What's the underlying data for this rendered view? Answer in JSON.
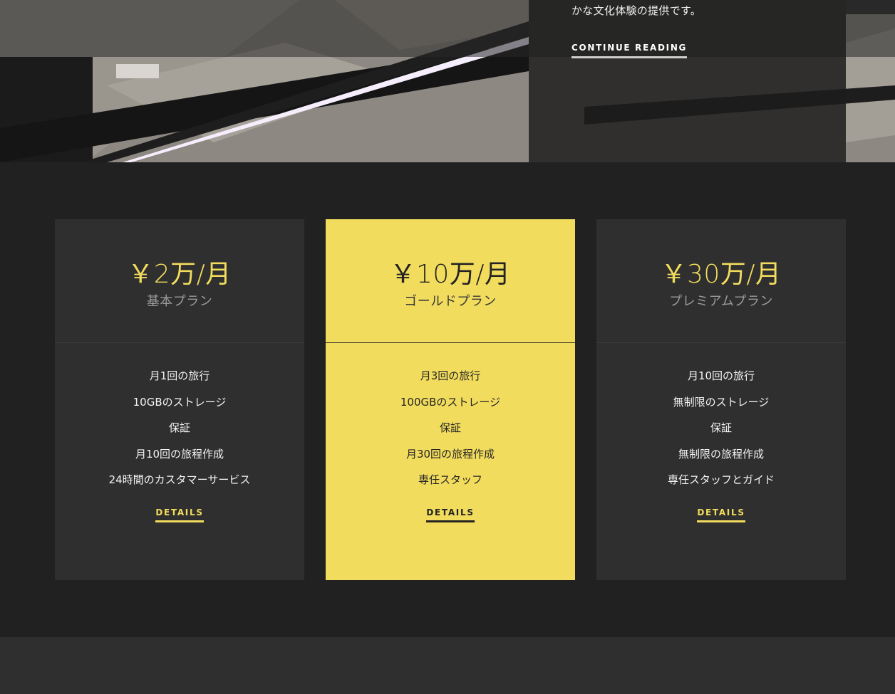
{
  "colors": {
    "accent": "#f2dc5d",
    "background": "#212121",
    "card": "#2f2f2f"
  },
  "hero": {
    "text": "かな文化体験の提供です。",
    "link_label": "CONTINUE READING"
  },
  "pricing": {
    "plans": [
      {
        "price": "￥2万/月",
        "name": "基本プラン",
        "features": [
          "月1回の旅行",
          "10GBのストレージ",
          "保証",
          "月10回の旅程作成",
          "24時間のカスタマーサービス"
        ],
        "button": "DETAILS"
      },
      {
        "price": "￥10万/月",
        "name": "ゴールドプラン",
        "features": [
          "月3回の旅行",
          "100GBのストレージ",
          "保証",
          "月30回の旅程作成",
          "専任スタッフ"
        ],
        "button": "DETAILS"
      },
      {
        "price": "￥30万/月",
        "name": "プレミアムプラン",
        "features": [
          "月10回の旅行",
          "無制限のストレージ",
          "保証",
          "無制限の旅程作成",
          "専任スタッフとガイド"
        ],
        "button": "DETAILS"
      }
    ]
  }
}
